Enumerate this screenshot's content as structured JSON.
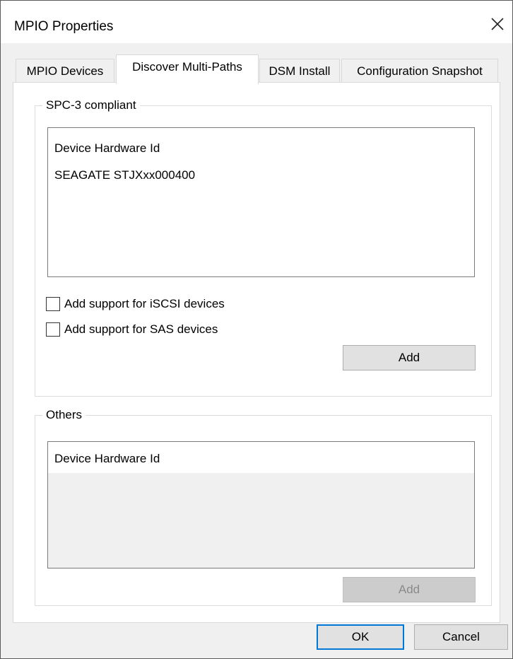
{
  "window": {
    "title": "MPIO Properties"
  },
  "tabs": [
    {
      "label": "MPIO Devices"
    },
    {
      "label": "Discover Multi-Paths"
    },
    {
      "label": "DSM Install"
    },
    {
      "label": "Configuration Snapshot"
    }
  ],
  "active_tab": "Discover Multi-Paths",
  "spc3": {
    "legend": "SPC-3 compliant",
    "list_items": [
      "Device Hardware Id",
      "SEAGATE STJXxx000400"
    ],
    "iscsi_label": "Add support for iSCSI devices",
    "iscsi_checked": false,
    "sas_label": "Add support for SAS devices",
    "sas_checked": false,
    "add_label": "Add"
  },
  "others": {
    "legend": "Others",
    "list_items": [
      "Device Hardware Id"
    ],
    "add_label": "Add"
  },
  "footer": {
    "ok_label": "OK",
    "cancel_label": "Cancel"
  },
  "icons": {
    "close": "close-icon"
  },
  "colors": {
    "focus_border": "#0078d7",
    "dialog_bg": "#f0f0f0"
  }
}
